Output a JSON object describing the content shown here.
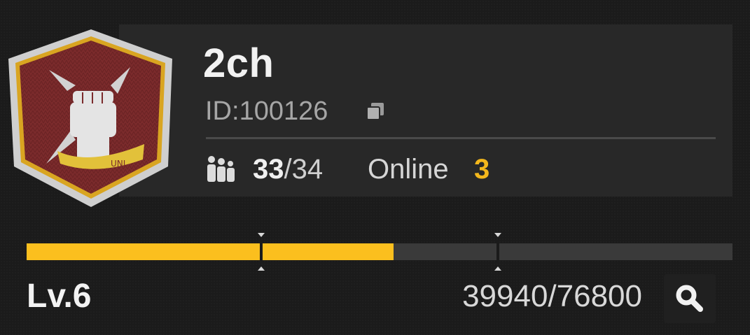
{
  "guild": {
    "name": "2ch",
    "id_label": "ID:",
    "id_value": "100126",
    "members_current": "33",
    "members_separator": "/",
    "members_max": "34",
    "online_label": "Online",
    "online_count": "3",
    "emblem_text": "UNI"
  },
  "level": {
    "label": "Lv.6",
    "xp_text": "39940/76800",
    "xp_current": 39940,
    "xp_max": 76800
  },
  "colors": {
    "accent": "#fbbf1e",
    "emblem_fill": "#7a2a2a",
    "emblem_border": "#d9a521"
  },
  "icons": [
    "copy-icon",
    "members-icon",
    "search-icon",
    "guild-emblem-icon"
  ]
}
